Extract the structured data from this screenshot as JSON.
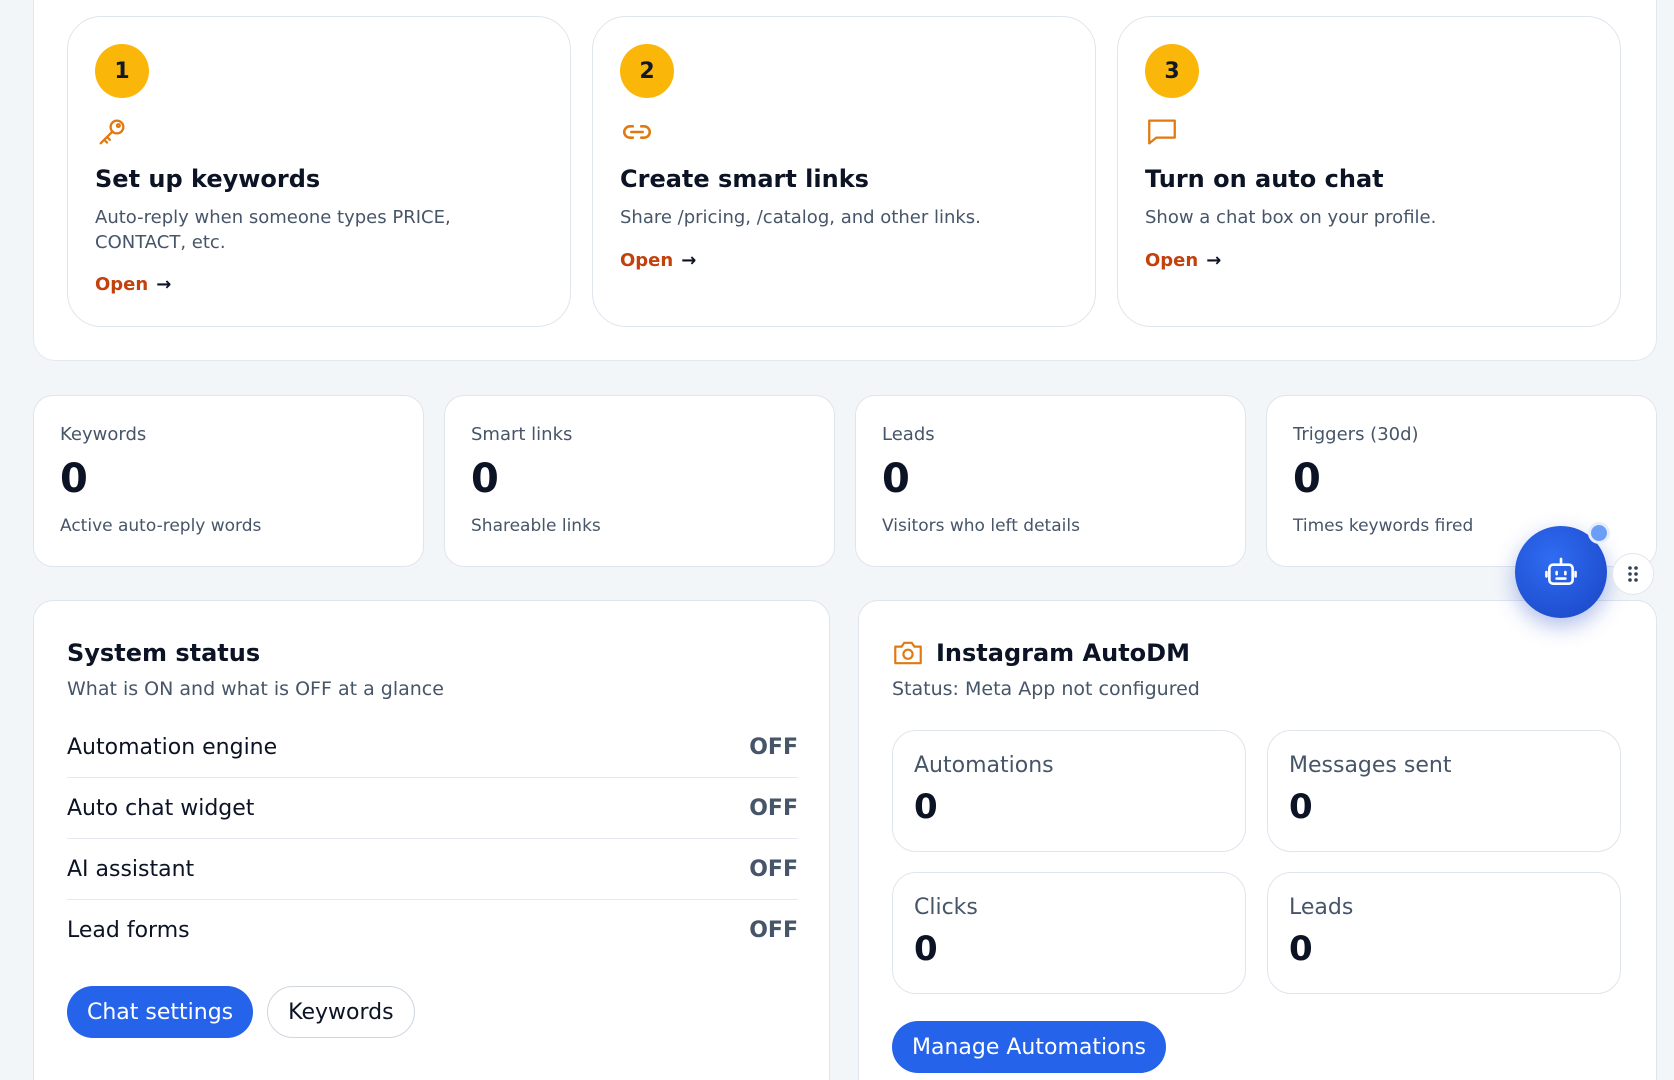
{
  "steps": [
    {
      "number": "1",
      "icon": "key-icon",
      "title": "Set up keywords",
      "desc": "Auto-reply when someone types PRICE, CONTACT, etc.",
      "link": "Open"
    },
    {
      "number": "2",
      "icon": "link-icon",
      "title": "Create smart links",
      "desc": "Share /pricing, /catalog, and other links.",
      "link": "Open"
    },
    {
      "number": "3",
      "icon": "chat-bubble-icon",
      "title": "Turn on auto chat",
      "desc": "Show a chat box on your profile.",
      "link": "Open"
    }
  ],
  "stats": [
    {
      "label": "Keywords",
      "value": "0",
      "sub": "Active auto-reply words"
    },
    {
      "label": "Smart links",
      "value": "0",
      "sub": "Shareable links"
    },
    {
      "label": "Leads",
      "value": "0",
      "sub": "Visitors who left details"
    },
    {
      "label": "Triggers (30d)",
      "value": "0",
      "sub": "Times keywords fired"
    }
  ],
  "system_status": {
    "title": "System status",
    "subtitle": "What is ON and what is OFF at a glance",
    "rows": [
      {
        "name": "Automation engine",
        "value": "OFF"
      },
      {
        "name": "Auto chat widget",
        "value": "OFF"
      },
      {
        "name": "AI assistant",
        "value": "OFF"
      },
      {
        "name": "Lead forms",
        "value": "OFF"
      }
    ],
    "buttons": {
      "primary": "Chat settings",
      "secondary": "Keywords"
    }
  },
  "instagram": {
    "icon": "camera-icon",
    "title": "Instagram AutoDM",
    "status": "Status: Meta App not configured",
    "metrics": [
      {
        "label": "Automations",
        "value": "0"
      },
      {
        "label": "Messages sent",
        "value": "0"
      },
      {
        "label": "Clicks",
        "value": "0"
      },
      {
        "label": "Leads",
        "value": "0"
      }
    ],
    "button": "Manage Automations"
  },
  "colors": {
    "accent_orange": "#c2410c",
    "step_badge": "#fbb60a",
    "primary_blue": "#2563eb"
  }
}
